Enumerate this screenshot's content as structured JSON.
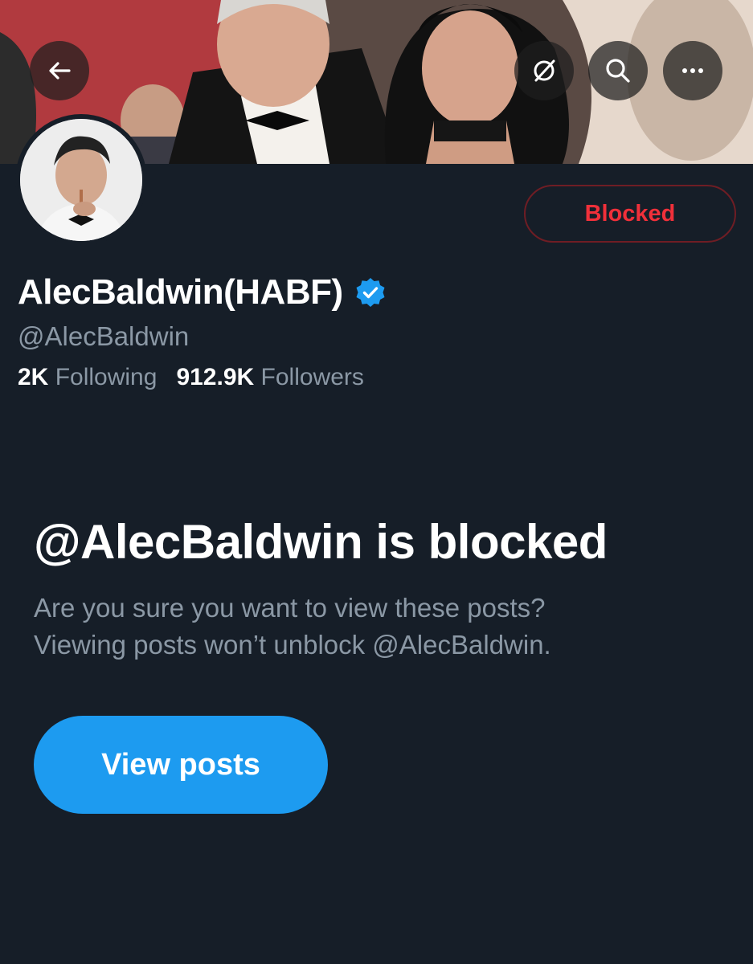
{
  "header": {
    "back_icon": "arrow-left-icon",
    "grok_icon": "grok-icon",
    "search_icon": "search-icon",
    "more_icon": "more-horizontal-icon"
  },
  "profile": {
    "display_name": "AlecBaldwin(HABF)",
    "verified_icon": "verified-badge-icon",
    "handle": "@AlecBaldwin",
    "following_count": "2K",
    "following_label": "Following",
    "followers_count": "912.9K",
    "followers_label": "Followers",
    "blocked_button_label": "Blocked"
  },
  "blocked_notice": {
    "title": "@AlecBaldwin is blocked",
    "line1": "Are you sure you want to view these posts?",
    "line2": "Viewing posts won’t unblock @AlecBaldwin.",
    "button_label": "View posts"
  },
  "colors": {
    "background": "#161e28",
    "accent_blue": "#1d9bf0",
    "blocked_red": "#f0303a",
    "secondary_text": "#8b98a5"
  }
}
